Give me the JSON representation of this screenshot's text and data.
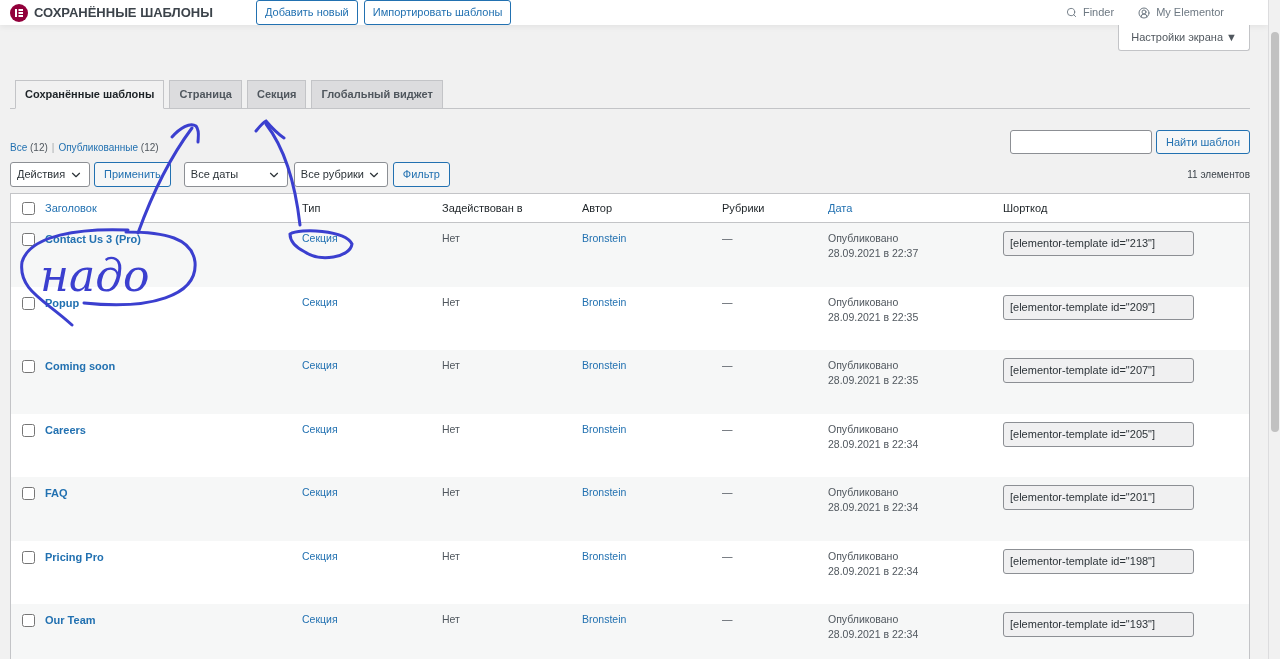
{
  "header": {
    "title": "СОХРАНЁННЫЕ ШАБЛОНЫ",
    "buttons": [
      "Добавить новый",
      "Импортировать шаблоны"
    ],
    "finder": "Finder",
    "account": "My Elementor"
  },
  "screen_options": "Настройки экрана ▼",
  "tabs": [
    {
      "label": "Сохранённые шаблоны",
      "selected": true
    },
    {
      "label": "Страница",
      "selected": false
    },
    {
      "label": "Секция",
      "selected": false
    },
    {
      "label": "Глобальный виджет",
      "selected": false
    }
  ],
  "view_separator": "|",
  "views": [
    {
      "label": "Все",
      "count": "(12)"
    },
    {
      "label": "Опубликованные",
      "count": "(12)"
    }
  ],
  "search": {
    "button": "Найти шаблон"
  },
  "filters": {
    "actions": "Действия",
    "apply": "Применить",
    "dates": "Все даты",
    "categories": "Все рубрики",
    "filter": "Фильтр"
  },
  "item_count": "11 элементов",
  "table": {
    "select_all_checked": false,
    "columns": [
      {
        "label": "Заголовок",
        "sortable": true
      },
      {
        "label": "Тип",
        "sortable": false
      },
      {
        "label": "Задействован в",
        "sortable": false
      },
      {
        "label": "Автор",
        "sortable": false
      },
      {
        "label": "Рубрики",
        "sortable": false
      },
      {
        "label": "Дата",
        "sortable": true
      },
      {
        "label": "Шорткод",
        "sortable": false
      }
    ],
    "rows": [
      {
        "checked": false,
        "title": "Contact Us 3 (Pro)",
        "type": "Секция",
        "used": "Нет",
        "author": "Bronstein",
        "categories": "—",
        "status": "Опубликовано",
        "date": "28.09.2021 в 22:37",
        "shortcode": "[elementor-template id=\"213\"]"
      },
      {
        "checked": false,
        "title": "Popup",
        "type": "Секция",
        "used": "Нет",
        "author": "Bronstein",
        "categories": "—",
        "status": "Опубликовано",
        "date": "28.09.2021 в 22:35",
        "shortcode": "[elementor-template id=\"209\"]"
      },
      {
        "checked": false,
        "title": "Coming soon",
        "type": "Секция",
        "used": "Нет",
        "author": "Bronstein",
        "categories": "—",
        "status": "Опубликовано",
        "date": "28.09.2021 в 22:35",
        "shortcode": "[elementor-template id=\"207\"]"
      },
      {
        "checked": false,
        "title": "Careers",
        "type": "Секция",
        "used": "Нет",
        "author": "Bronstein",
        "categories": "—",
        "status": "Опубликовано",
        "date": "28.09.2021 в 22:34",
        "shortcode": "[elementor-template id=\"205\"]"
      },
      {
        "checked": false,
        "title": "FAQ",
        "type": "Секция",
        "used": "Нет",
        "author": "Bronstein",
        "categories": "—",
        "status": "Опубликовано",
        "date": "28.09.2021 в 22:34",
        "shortcode": "[elementor-template id=\"201\"]"
      },
      {
        "checked": false,
        "title": "Pricing Pro",
        "type": "Секция",
        "used": "Нет",
        "author": "Bronstein",
        "categories": "—",
        "status": "Опубликовано",
        "date": "28.09.2021 в 22:34",
        "shortcode": "[elementor-template id=\"198\"]"
      },
      {
        "checked": false,
        "title": "Our Team",
        "type": "Секция",
        "used": "Нет",
        "author": "Bronstein",
        "categories": "—",
        "status": "Опубликовано",
        "date": "28.09.2021 в 22:34",
        "shortcode": "[elementor-template id=\"193\"]"
      }
    ]
  },
  "annotation": {
    "note": "надо"
  }
}
